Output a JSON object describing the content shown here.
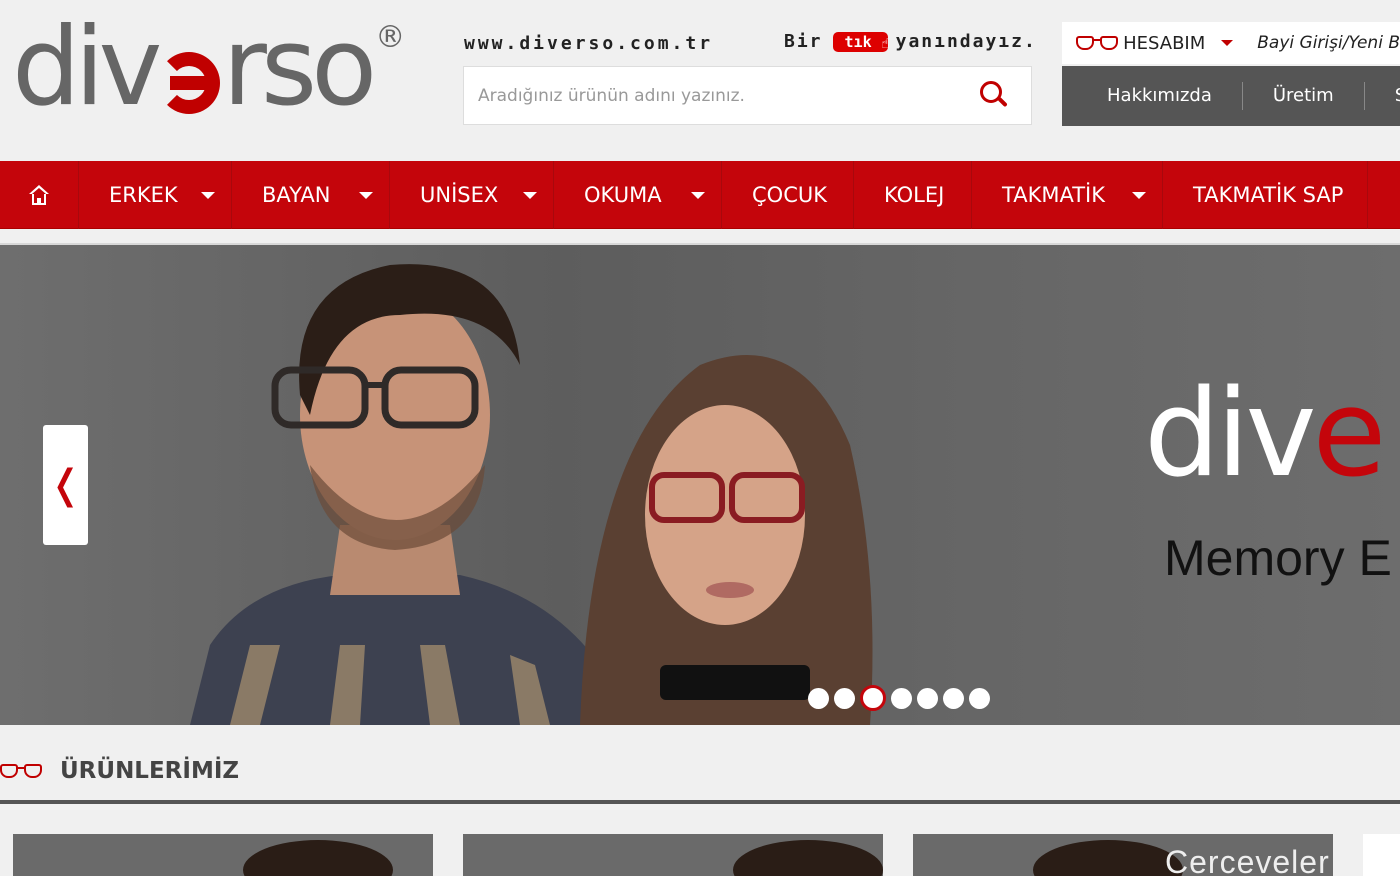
{
  "header": {
    "logo_text_left": "div",
    "logo_text_right": "rso",
    "logo_reg": "®",
    "site_url": "www.diverso.com.tr",
    "slogan_before": "Bir",
    "slogan_badge": "tık",
    "slogan_after": "yanındayız.",
    "search": {
      "placeholder": "Aradığınız ürünün adını yazınız.",
      "icon": "search-icon"
    },
    "account": {
      "label": "HESABIM",
      "dealer_link": "Bayi Girişi/Yeni B"
    },
    "corp_nav": [
      "Hakkımızda",
      "Üretim",
      "Se"
    ]
  },
  "main_nav": {
    "home_icon": "home-icon",
    "items": [
      {
        "label": "ERKEK",
        "dropdown": true
      },
      {
        "label": "BAYAN",
        "dropdown": true
      },
      {
        "label": "UNİSEX",
        "dropdown": true
      },
      {
        "label": "OKUMA",
        "dropdown": true
      },
      {
        "label": "ÇOCUK",
        "dropdown": false
      },
      {
        "label": "KOLEJ",
        "dropdown": false
      },
      {
        "label": "TAKMATİK",
        "dropdown": true
      },
      {
        "label": "TAKMATİK SAP",
        "dropdown": false
      }
    ]
  },
  "hero": {
    "brand_left": "div",
    "brand_right": "e",
    "tagline": "Memory E",
    "prev_label": "❬",
    "dots_count": 7,
    "active_dot": 3
  },
  "products": {
    "title": "ÜRÜNLERİMİZ",
    "card_caption": "Cerceveler"
  },
  "colors": {
    "brand_red": "#c4050b",
    "dark_gray": "#555555",
    "bg": "#f0f0f0"
  }
}
